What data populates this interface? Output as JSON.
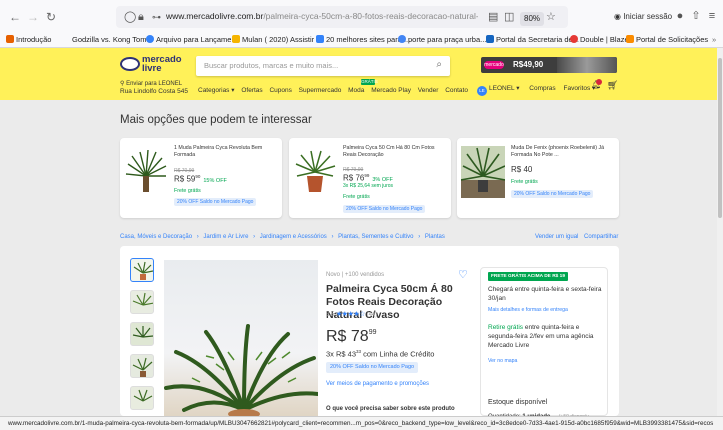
{
  "browser": {
    "url_domain": "www.mercadolivre.com.br",
    "url_path": "/palmeira-cyca-50cm-a-80-fotos-reais-decoracao-natural-cvaso/up/MLI",
    "zoom": "80%",
    "signin_label": "Iniciar sessão",
    "bookmarks": [
      {
        "label": "Introdução",
        "color": "#e66000"
      },
      {
        "label": "Godzilla vs. Kong Tom...",
        "color": ""
      },
      {
        "label": "Arquivo para Lançame...",
        "color": "#3483fa"
      },
      {
        "label": "Mulan ( 2020) Assistir ...",
        "color": "#f5b400"
      },
      {
        "label": "20 melhores sites para ...",
        "color": "#3483fa"
      },
      {
        "label": "porte para praça urba...",
        "color": "#4285f4"
      },
      {
        "label": "Portal da Secretaria de...",
        "color": "#1565c0"
      },
      {
        "label": "Double | Blaze",
        "color": "#e53935"
      },
      {
        "label": "Portal de Solicitações",
        "color": "#fb8c00"
      }
    ]
  },
  "header": {
    "logo_line1": "mercado",
    "logo_line2": "livre",
    "search_placeholder": "Buscar produtos, marcas e muito mais...",
    "promo_badge": "mercado",
    "promo_price": "R$49,90",
    "address_line1": "Enviar para LEONEL",
    "address_line2": "Rua Lindolfo Costa 545",
    "categories": [
      "Categorias ▾",
      "Ofertas",
      "Cupons",
      "Supermercado",
      "Moda",
      "Mercado Play",
      "Vender",
      "Contato"
    ],
    "new_badge": "GRÁTIS",
    "user_initials": "LE",
    "user_name": "LEONEL ▾",
    "purchases": "Compras",
    "favorites": "Favoritos ▾"
  },
  "recommendations": {
    "title": "Mais opções que podem te interessar",
    "items": [
      {
        "name": "1 Muda Palmeira Cyca Revoluta Bem Formada",
        "old_price": "R$ 70,99",
        "price": "R$ 59",
        "cents": "90",
        "off": "15% OFF",
        "installment": "",
        "shipping": "Frete grátis",
        "pill": "20% OFF Saldo no Mercado Pago"
      },
      {
        "name": "Palmeira Cyca 50 Cm Há 80 Cm Fotos Reais Decoração",
        "old_price": "R$ 79,99",
        "price": "R$ 76",
        "cents": "99",
        "off": "3% OFF",
        "installment": "3x R$ 25,64 sem juros",
        "shipping": "Frete grátis",
        "pill": "20% OFF Saldo no Mercado Pago"
      },
      {
        "name": "Muda De Fenix (phoenix Roebelenii) Já Formada No Pote ...",
        "old_price": "",
        "price": "R$ 40",
        "cents": "",
        "off": "",
        "installment": "",
        "shipping": "Frete grátis",
        "pill": "20% OFF Saldo no Mercado Pago"
      }
    ]
  },
  "breadcrumb": {
    "items": [
      "Casa, Móveis e Decoração",
      "›",
      "Jardim e Ar Livre",
      "›",
      "Jardinagem e Acessórios",
      "›",
      "Plantas, Sementes e Cultivo",
      "›",
      "Plantas"
    ],
    "sell_similar": "Vender um igual",
    "share": "Compartilhar"
  },
  "product": {
    "condition": "Novo | +100 vendidos",
    "title": "Palmeira Cyca 50cm Á 80 Fotos Reais Decoração Natural C/vaso",
    "rating_value": "3.5",
    "rating_stars": "★★★★☆",
    "rating_count": "(44)",
    "price": "R$ 78",
    "price_cents": "99",
    "installment_prefix": "3x",
    "installment_amount": "R$ 43",
    "installment_cents": "33",
    "installment_suffix": "com Linha de Crédito",
    "pill": "20% OFF Saldo no Mercado Pago",
    "payment_link": "Ver meios de pagamento e promoções",
    "need_to_know": "O que você precisa saber sobre este produto"
  },
  "buybox": {
    "free_badge": "FRETE GRÁTIS ACIMA DE R$ 19",
    "arrival": "Chegará entre quinta-feira e sexta-feira 30/jan",
    "details_link": "Mais detalhes e formas de entrega",
    "pickup_green": "Retire grátis",
    "pickup_rest": " entre quinta-feira e segunda-feira 2/fev em uma agência Mercado Livre",
    "map_link": "Ver no mapa",
    "stock": "Estoque disponível",
    "qty_label": "Quantidade:",
    "qty_value": "1 unidade",
    "qty_avail": "(+50 disponív..."
  },
  "statusbar": {
    "url": "www.mercadolivre.com.br/1-muda-palmeira-cyca-revoluta-bem-formada/up/MLBU3047662821#polycard_client=recommen...m_pos=0&reco_backend_type=low_level&reco_id=3c8edce0-7d33-4ae1-915d-a0bc1685f959&wid=MLB3993381475&sid=recos"
  }
}
